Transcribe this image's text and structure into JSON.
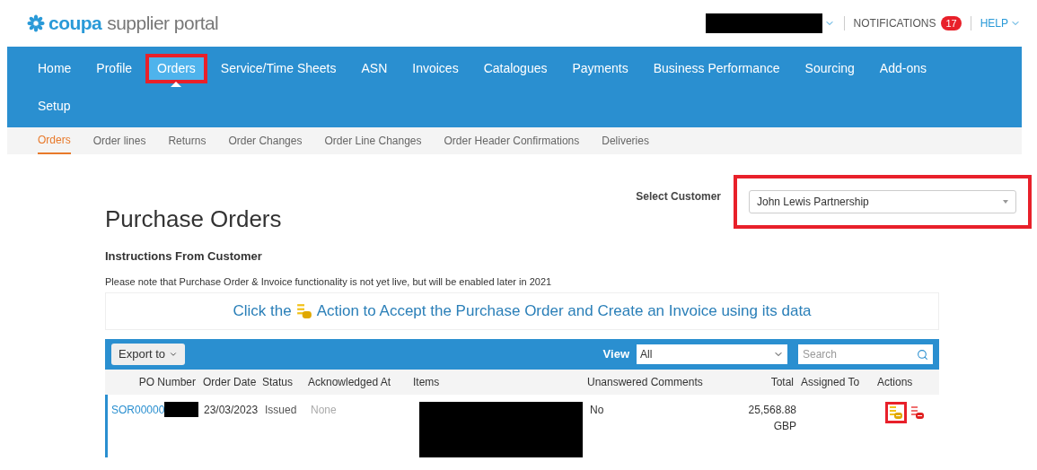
{
  "header": {
    "logo": {
      "brand": "coupa",
      "product": "supplier portal"
    },
    "user_menu": {
      "redacted": true
    },
    "notifications": {
      "label": "NOTIFICATIONS",
      "count": "17"
    },
    "help": "HELP"
  },
  "nav": [
    {
      "label": "Home",
      "selected": false,
      "highlighted": false
    },
    {
      "label": "Profile",
      "selected": false,
      "highlighted": false
    },
    {
      "label": "Orders",
      "selected": true,
      "highlighted": true
    },
    {
      "label": "Service/Time Sheets",
      "selected": false,
      "highlighted": false
    },
    {
      "label": "ASN",
      "selected": false,
      "highlighted": false
    },
    {
      "label": "Invoices",
      "selected": false,
      "highlighted": false
    },
    {
      "label": "Catalogues",
      "selected": false,
      "highlighted": false
    },
    {
      "label": "Payments",
      "selected": false,
      "highlighted": false
    },
    {
      "label": "Business Performance",
      "selected": false,
      "highlighted": false
    },
    {
      "label": "Sourcing",
      "selected": false,
      "highlighted": false
    },
    {
      "label": "Add-ons",
      "selected": false,
      "highlighted": false
    },
    {
      "label": "Setup",
      "selected": false,
      "highlighted": false
    }
  ],
  "subnav": [
    {
      "label": "Orders",
      "selected": true
    },
    {
      "label": "Order lines",
      "selected": false
    },
    {
      "label": "Returns",
      "selected": false
    },
    {
      "label": "Order Changes",
      "selected": false
    },
    {
      "label": "Order Line Changes",
      "selected": false
    },
    {
      "label": "Order Header Confirmations",
      "selected": false
    },
    {
      "label": "Deliveries",
      "selected": false
    }
  ],
  "customer": {
    "label": "Select Customer",
    "value": "John Lewis Partnership",
    "highlighted": true
  },
  "page_title": "Purchase Orders",
  "instructions": {
    "heading": "Instructions From Customer",
    "text": "Please note that Purchase Order & Invoice functionality is not yet live, but will be enabled later in 2021"
  },
  "banner": {
    "before": "Click the",
    "after": "Action to Accept the Purchase Order and Create an Invoice using its data"
  },
  "toolbar": {
    "export": "Export to",
    "view_label": "View",
    "view_value": "All",
    "search_placeholder": "Search"
  },
  "table": {
    "columns": [
      "PO Number",
      "Order Date",
      "Status",
      "Acknowledged At",
      "Items",
      "Unanswered Comments",
      "Total",
      "Assigned To",
      "Actions"
    ],
    "rows": [
      {
        "po_number": "SOR00000",
        "po_redacted": true,
        "order_date": "23/03/2023",
        "status": "Issued",
        "acknowledged_at": "None",
        "items_redacted": true,
        "unanswered_comments": "No",
        "total": "25,568.88",
        "currency": "GBP",
        "actions": [
          {
            "kind": "invoice",
            "highlighted": true
          },
          {
            "kind": "reject",
            "highlighted": false
          }
        ]
      }
    ]
  }
}
